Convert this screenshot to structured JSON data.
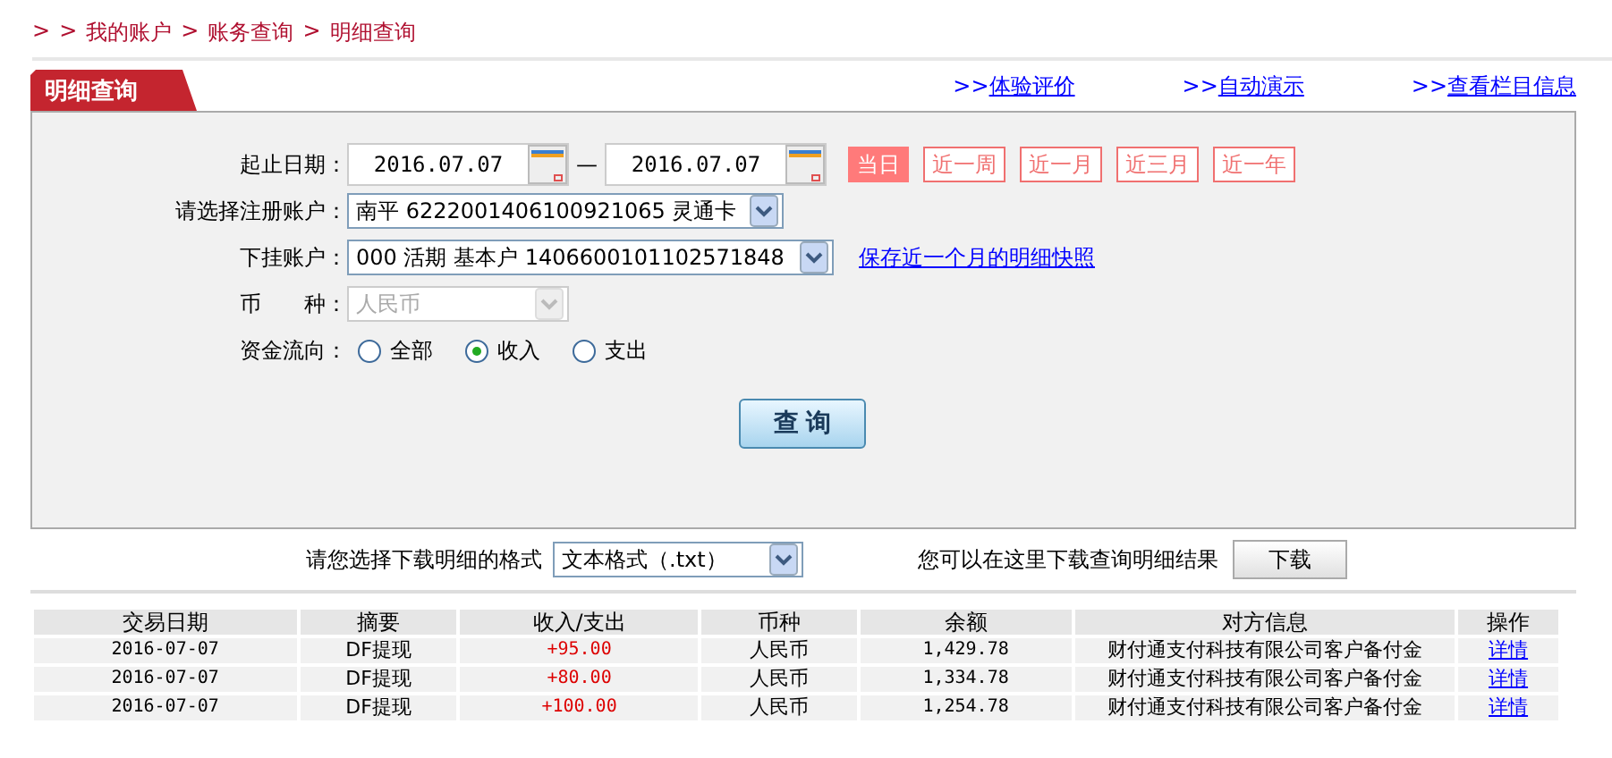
{
  "breadcrumb": {
    "lead": ">",
    "items": [
      {
        "separator": ">",
        "label": "我的账户"
      },
      {
        "separator": ">",
        "label": "账务查询"
      },
      {
        "separator": ">",
        "label": "明细查询"
      }
    ]
  },
  "panel_tab": "明细查询",
  "links": [
    {
      "prefix": ">>",
      "label": "体验评价"
    },
    {
      "prefix": ">>",
      "label": "自动演示"
    },
    {
      "prefix": ">>",
      "label": "查看栏目信息"
    }
  ],
  "form": {
    "date_range": {
      "label": "起止日期：",
      "from": "2016.07.07",
      "separator": "—",
      "to": "2016.07.07"
    },
    "quick_ranges": [
      {
        "label": "当日",
        "selected": true
      },
      {
        "label": "近一周",
        "selected": false
      },
      {
        "label": "近一月",
        "selected": false
      },
      {
        "label": "近三月",
        "selected": false
      },
      {
        "label": "近一年",
        "selected": false
      }
    ],
    "account": {
      "label": "请选择注册账户：",
      "value": "南平  6222001406100921065 灵通卡",
      "disabled": false
    },
    "sub_account": {
      "label": "下挂账户：",
      "value": "000 活期 基本户 1406600101102571848",
      "disabled": false,
      "link": "保存近一个月的明细快照"
    },
    "currency": {
      "label": "币　　种：",
      "value": "人民币",
      "disabled": true
    },
    "flow": {
      "label": "资金流向：",
      "options": [
        {
          "label": "全部",
          "selected": false
        },
        {
          "label": "收入",
          "selected": true
        },
        {
          "label": "支出",
          "selected": false
        }
      ]
    },
    "query_button": "查 询"
  },
  "download": {
    "format_label": "请您选择下载明细的格式",
    "format": "文本格式（.txt）",
    "hint": "您可以在这里下载查询明细结果",
    "button": "下载"
  },
  "table": {
    "columns": [
      "交易日期",
      "摘要",
      "收入/支出",
      "币种",
      "余额",
      "对方信息",
      "操作"
    ],
    "rows": [
      {
        "date": "2016-07-07",
        "summary": "DF提现",
        "amount": "+95.00",
        "currency": "人民币",
        "balance": "1,429.78",
        "counterparty": "财付通支付科技有限公司客户备付金",
        "action": "详情"
      },
      {
        "date": "2016-07-07",
        "summary": "DF提现",
        "amount": "+80.00",
        "currency": "人民币",
        "balance": "1,334.78",
        "counterparty": "财付通支付科技有限公司客户备付金",
        "action": "详情"
      },
      {
        "date": "2016-07-07",
        "summary": "DF提现",
        "amount": "+100.00",
        "currency": "人民币",
        "balance": "1,254.78",
        "counterparty": "财付通支付科技有限公司客户备付金",
        "action": "详情"
      }
    ]
  }
}
